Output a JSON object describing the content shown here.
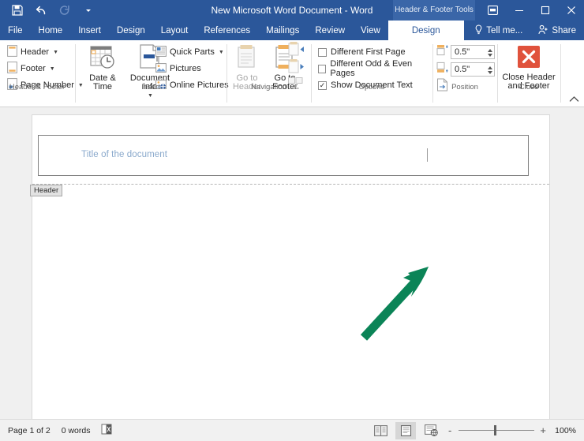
{
  "titlebar": {
    "document_title": "New Microsoft Word Document - Word",
    "contextual_tools": "Header & Footer Tools",
    "quick_access": [
      {
        "name": "save-icon",
        "label": "Save"
      },
      {
        "name": "undo-icon",
        "label": "Undo"
      },
      {
        "name": "redo-icon",
        "label": "Redo"
      },
      {
        "name": "customize-quick-access-icon",
        "label": "Customize Quick Access Toolbar"
      }
    ],
    "window_controls": [
      {
        "name": "ribbon-display-options-icon",
        "label": "Ribbon Display Options"
      },
      {
        "name": "minimize-icon",
        "label": "Minimize"
      },
      {
        "name": "restore-icon",
        "label": "Restore Down"
      },
      {
        "name": "close-icon",
        "label": "Close"
      }
    ]
  },
  "tabs": [
    {
      "label": "File",
      "active": false
    },
    {
      "label": "Home",
      "active": false
    },
    {
      "label": "Insert",
      "active": false
    },
    {
      "label": "Design",
      "active": false
    },
    {
      "label": "Layout",
      "active": false
    },
    {
      "label": "References",
      "active": false
    },
    {
      "label": "Mailings",
      "active": false
    },
    {
      "label": "Review",
      "active": false
    },
    {
      "label": "View",
      "active": false
    },
    {
      "label": "Design",
      "active": true
    }
  ],
  "tab_right": {
    "tell_me": "Tell me...",
    "share": "Share"
  },
  "ribbon": {
    "groups": [
      {
        "title": "Header & Footer",
        "items": [
          {
            "label": "Header",
            "icon": "header-page-icon",
            "dropdown": true
          },
          {
            "label": "Footer",
            "icon": "footer-page-icon",
            "dropdown": true
          },
          {
            "label": "Page Number",
            "icon": "page-number-icon",
            "dropdown": true
          }
        ]
      },
      {
        "title": "Insert",
        "items": [
          {
            "label": "Date & Time",
            "icon": "calendar-clock-icon",
            "dropdown": false
          },
          {
            "label": "Document Info",
            "icon": "document-info-icon",
            "dropdown": true
          },
          {
            "label": "Quick Parts",
            "icon": "quick-parts-icon",
            "dropdown": true
          },
          {
            "label": "Pictures",
            "icon": "pictures-icon",
            "dropdown": false
          },
          {
            "label": "Online Pictures",
            "icon": "online-pictures-icon",
            "dropdown": false
          }
        ]
      },
      {
        "title": "Navigation",
        "items": [
          {
            "label": "Go to Header",
            "icon": "go-to-header-icon",
            "disabled": true
          },
          {
            "label": "Go to Footer",
            "icon": "go-to-footer-icon",
            "disabled": false
          },
          {
            "label": "Previous",
            "icon": "previous-section-icon",
            "disabled": true
          },
          {
            "label": "Next",
            "icon": "next-section-icon",
            "disabled": true
          },
          {
            "label": "Link to Previous",
            "icon": "link-to-previous-icon",
            "disabled": true
          }
        ]
      },
      {
        "title": "Options",
        "items": [
          {
            "label": "Different First Page",
            "checked": false
          },
          {
            "label": "Different Odd & Even Pages",
            "checked": false
          },
          {
            "label": "Show Document Text",
            "checked": true
          }
        ]
      },
      {
        "title": "Position",
        "items": [
          {
            "label": "Header from Top",
            "value": "0.5\"",
            "icon": "header-from-top-icon"
          },
          {
            "label": "Footer from Bottom",
            "value": "0.5\"",
            "icon": "footer-from-bottom-icon"
          },
          {
            "label": "Insert Alignment Tab",
            "icon": "insert-alignment-tab-icon"
          }
        ]
      },
      {
        "title": "Close",
        "items": [
          {
            "label": "Close Header and Footer",
            "icon": "close-header-footer-icon"
          }
        ]
      }
    ],
    "collapse_label": "^"
  },
  "document": {
    "header_title_text": "Title of the document",
    "header_tag_label": "Header"
  },
  "annotation": {
    "arrow_color": "#0b8457",
    "description": "green-arrow-pointing-to-header-right-tab"
  },
  "statusbar": {
    "page_info": "Page 1 of 2",
    "word_count": "0 words",
    "proofing_icon": "proofing-errors-icon",
    "views": [
      {
        "name": "read-mode-icon",
        "label": "Read Mode",
        "active": false
      },
      {
        "name": "print-layout-icon",
        "label": "Print Layout",
        "active": true
      },
      {
        "name": "web-layout-icon",
        "label": "Web Layout",
        "active": false
      }
    ],
    "zoom_out": "-",
    "zoom_in": "+",
    "zoom_level": "100%"
  }
}
